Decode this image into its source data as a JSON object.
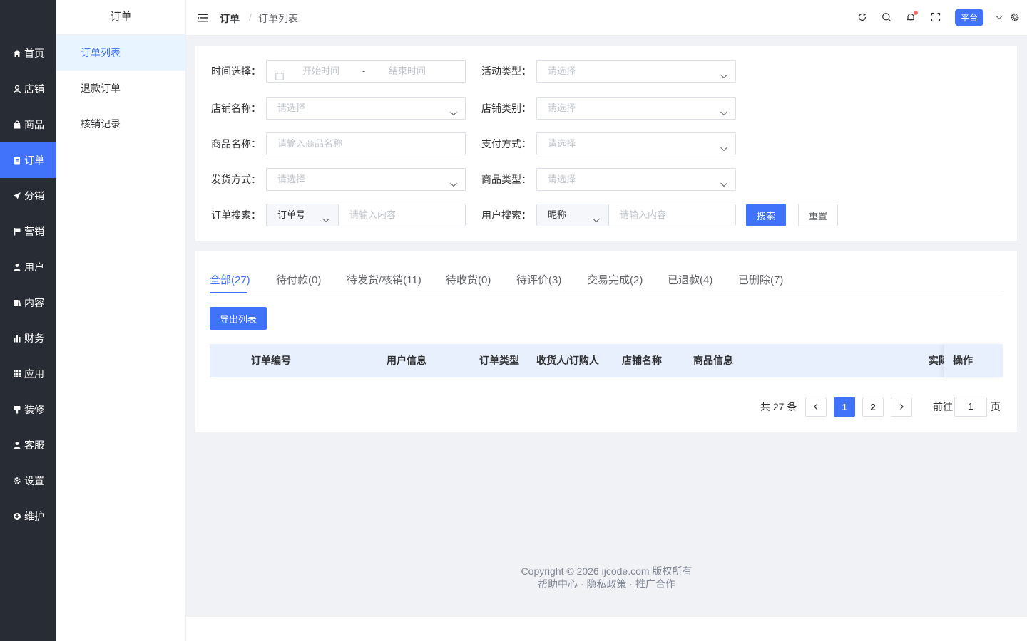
{
  "sidebar": {
    "items": [
      {
        "label": "首页",
        "icon": "home-icon"
      },
      {
        "label": "店铺",
        "icon": "shop-icon"
      },
      {
        "label": "商品",
        "icon": "bag-icon"
      },
      {
        "label": "订单",
        "icon": "clipboard-icon"
      },
      {
        "label": "分销",
        "icon": "send-icon"
      },
      {
        "label": "营销",
        "icon": "flag-icon"
      },
      {
        "label": "用户",
        "icon": "user-icon"
      },
      {
        "label": "内容",
        "icon": "book-icon"
      },
      {
        "label": "财务",
        "icon": "bar-chart-icon"
      },
      {
        "label": "应用",
        "icon": "grid-icon"
      },
      {
        "label": "装修",
        "icon": "brush-icon"
      },
      {
        "label": "客服",
        "icon": "headset-icon"
      },
      {
        "label": "设置",
        "icon": "gear-icon"
      },
      {
        "label": "维护",
        "icon": "wrench-icon"
      }
    ],
    "active_label": "订单"
  },
  "submenu": {
    "title": "订单",
    "items": [
      "订单列表",
      "退款订单",
      "核销记录"
    ],
    "active_label": "订单列表"
  },
  "header": {
    "breadcrumb": {
      "parent": "订单",
      "separator": "/",
      "current": "订单列表"
    },
    "platform_label": "平台"
  },
  "search_form": {
    "time": {
      "label": "时间选择：",
      "start_placeholder": "开始时间",
      "range_separator": "-",
      "end_placeholder": "结束时间"
    },
    "activity_type": {
      "label": "活动类型：",
      "placeholder": "请选择"
    },
    "shop_name": {
      "label": "店铺名称：",
      "placeholder": "请选择"
    },
    "shop_category": {
      "label": "店铺类别：",
      "placeholder": "请选择"
    },
    "product_name": {
      "label": "商品名称：",
      "placeholder": "请输入商品名称"
    },
    "payment_method": {
      "label": "支付方式：",
      "placeholder": "请选择"
    },
    "delivery_method": {
      "label": "发货方式：",
      "placeholder": "请选择"
    },
    "product_type": {
      "label": "商品类型：",
      "placeholder": "请选择"
    },
    "order_search": {
      "label": "订单搜索：",
      "field_value": "订单号",
      "placeholder": "请输入内容"
    },
    "user_search": {
      "label": "用户搜索：",
      "field_value": "昵称",
      "placeholder": "请输入内容"
    },
    "search_button": "搜索",
    "reset_button": "重置"
  },
  "tabs": [
    {
      "label": "全部(27)",
      "active": true
    },
    {
      "label": "待付款(0)"
    },
    {
      "label": "待发货/核销(11)"
    },
    {
      "label": "待收货(0)"
    },
    {
      "label": "待评价(3)"
    },
    {
      "label": "交易完成(2)"
    },
    {
      "label": "已退款(4)"
    },
    {
      "label": "已删除(7)"
    }
  ],
  "export_button": "导出列表",
  "table": {
    "columns": [
      "订单编号",
      "用户信息",
      "订单类型",
      "收货人/订购人",
      "店铺名称",
      "商品信息",
      "实际",
      "操作"
    ]
  },
  "pagination": {
    "total_text": "共 27 条",
    "pages": [
      "1",
      "2"
    ],
    "current_page": "1",
    "goto_prefix": "前往",
    "goto_value": "1",
    "goto_suffix": "页"
  },
  "footer": {
    "copyright": "Copyright © 2026 ijcode.com 版权所有",
    "links": "帮助中心 · 隐私政策 · 推广合作"
  },
  "colors": {
    "sidebar_bg": "#282c34",
    "primary": "#4073fa",
    "submenu_active_bg": "#e8f4ff",
    "table_header_bg": "#e8f0fe",
    "page_bg": "#f0f2f5"
  }
}
